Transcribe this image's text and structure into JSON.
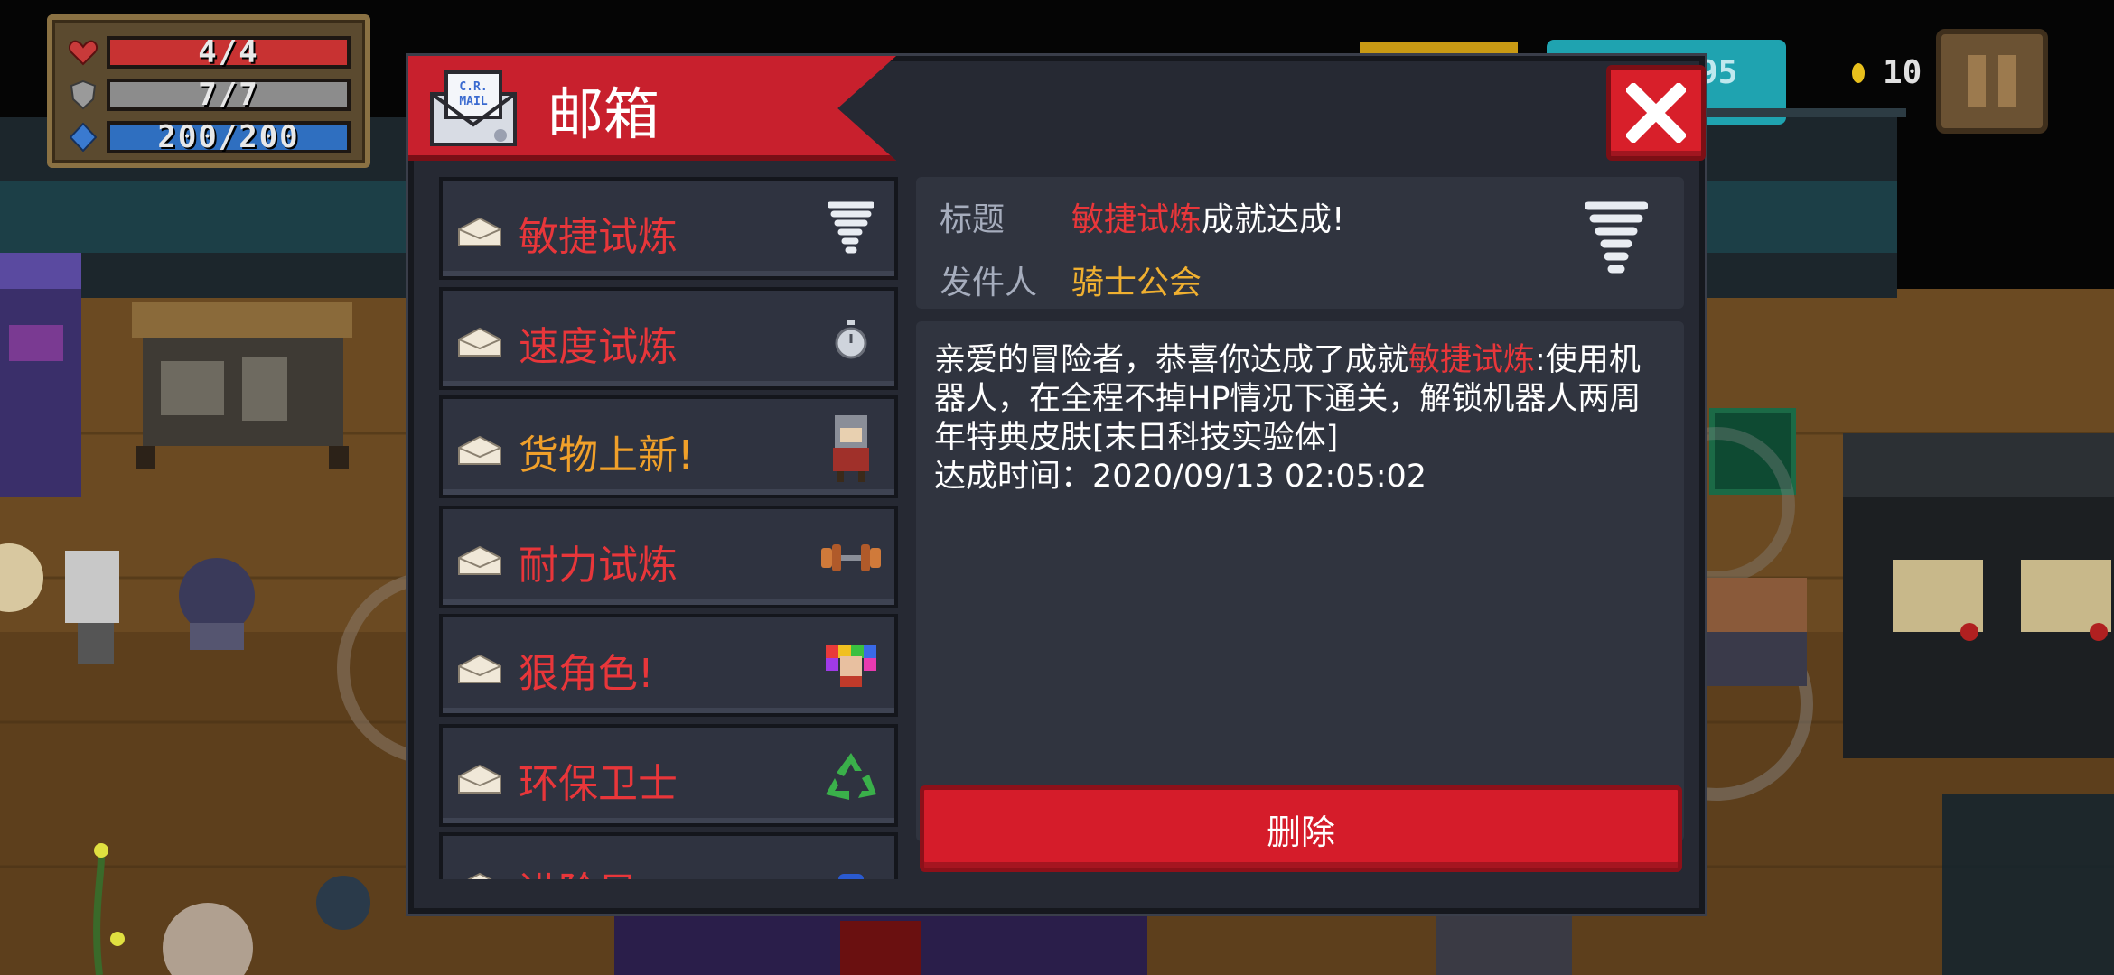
{
  "hud": {
    "health": "4/4",
    "armor": "7/7",
    "energy": "200/200",
    "health_fraction": 1.0,
    "armor_fraction": 1.0,
    "energy_fraction": 1.0,
    "coins": "10",
    "partial_value": "95"
  },
  "mailbox": {
    "title": "邮箱",
    "items": [
      {
        "label": "敏捷试炼",
        "color": "#e8363a",
        "icon": "tornado-icon"
      },
      {
        "label": "速度试炼",
        "color": "#e8363a",
        "icon": "stopwatch-icon"
      },
      {
        "label": "货物上新!",
        "color": "#f0a02a",
        "icon": "merchant-icon"
      },
      {
        "label": "耐力试炼",
        "color": "#e8363a",
        "icon": "dumbbell-icon"
      },
      {
        "label": "狠角色!",
        "color": "#e8363a",
        "icon": "character-icon"
      },
      {
        "label": "环保卫士",
        "color": "#e8363a",
        "icon": "recycle-icon"
      },
      {
        "label": "进阶目",
        "color": "#e8363a",
        "icon": "blue-item-icon"
      }
    ],
    "detail": {
      "subject_key": "标题",
      "subject_highlight": "敏捷试炼",
      "subject_rest": "成就达成!",
      "sender_key": "发件人",
      "sender": "骑士公会",
      "body_prefix": "亲爱的冒险者，恭喜你达成了成就",
      "body_highlight": "敏捷试炼",
      "body_rest": ":使用机器人，在全程不掉HP情况下通关，解锁机器人两周年特典皮肤[末日科技实验体]",
      "achieved_label": "达成时间：",
      "achieved_time": "2020/09/13 02:05:02",
      "delete_label": "删除"
    }
  },
  "colors": {
    "accent_red": "#e8363a",
    "accent_orange": "#f0a02a",
    "sender_yellow": "#f0b030"
  }
}
